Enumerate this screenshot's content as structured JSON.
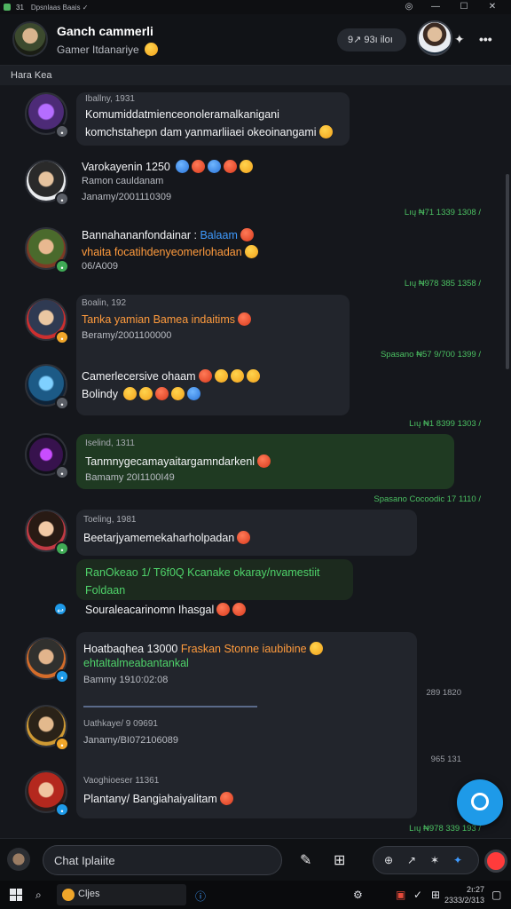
{
  "titlebar": {
    "num": "31",
    "title": "Dpsnlaas Baais  ✓",
    "icons": [
      "◎",
      "—",
      "☐",
      "✕"
    ]
  },
  "header": {
    "name": "Ganch cammerli",
    "subtitle": "Gamer Itdanariye",
    "pill": "9↗ 93ı iloı",
    "icons": [
      "✦",
      "•••"
    ]
  },
  "section": {
    "label": "Hara Kea"
  },
  "messages": [
    {
      "meta": "Iballny, 1931",
      "lines": [
        "Komumiddatmienceonoleramalkanigani",
        "komchstahepn dam yanmarliiaei okeoinangami"
      ]
    },
    {
      "meta": "Varokayenin 1250",
      "lines": [
        "Ramon cauldanam",
        "Janamy/2001110309"
      ],
      "ts": "Lıų  ₦71 1339  1308 /"
    },
    {
      "meta": "Bannahananfondainar :",
      "accent": "Balaam",
      "lines": [
        "vhaita focatihdenyeomerlohadan",
        "06/A009"
      ],
      "ts": "Lıų  ₦978 385  1358 /"
    },
    {
      "meta": "Boalin, 192",
      "lines": [
        "Tanka yamian Bamea indaitims",
        "Beramy/2001100000"
      ],
      "ts": "Spasano  ₦57 9/700  1399 /"
    },
    {
      "lines": [
        "Camerlecersive ohaam",
        "Bolindy"
      ],
      "ts": "Lıų  ₦1 8399  1303 /"
    },
    {
      "meta": "Iselind, 1311",
      "lines": [
        "Tanmnygecamayaitargamndarkenl",
        "Bamamy 20I1100I49"
      ],
      "ts": "Spasano Cocoodic  17  1110 /"
    },
    {
      "meta": "Toeling, 1981",
      "lines": [
        "Beetarjyamemekaharholpadan"
      ]
    },
    {
      "green": "RanOkeao 1/ T6f0Q Kcanake okaray/nvamestiit",
      "green2": "Foldaan",
      "lines": [
        "Souraleacarinomn Ihasgal"
      ]
    },
    {
      "meta": "Hoatbaqhea  13000",
      "accent": "Fraskan Stonne iaubibine",
      "lines": [
        "ehtaltalmeabantankal",
        "Bammy 1910:02:08"
      ],
      "ts": "289 1820"
    },
    {
      "meta": "Uathkaye/ 9 09691",
      "lines": [
        "Janamy/BI072106089"
      ],
      "ts": "965 131"
    },
    {
      "meta": "Vaoghioeser 11361",
      "lines": [
        "Plantany/ Bangiahaiyalitam"
      ],
      "ts": "Lıų  ₦978 339  193 /"
    }
  ],
  "composer": {
    "placeholder": "Chat Iplaiite",
    "icons": [
      "✎",
      "⊞",
      "⊕",
      "↗",
      "✶",
      "✦"
    ]
  },
  "taskbar": {
    "app_label": "Cljes",
    "time": "2ı:27",
    "date": "2333/2/313"
  }
}
